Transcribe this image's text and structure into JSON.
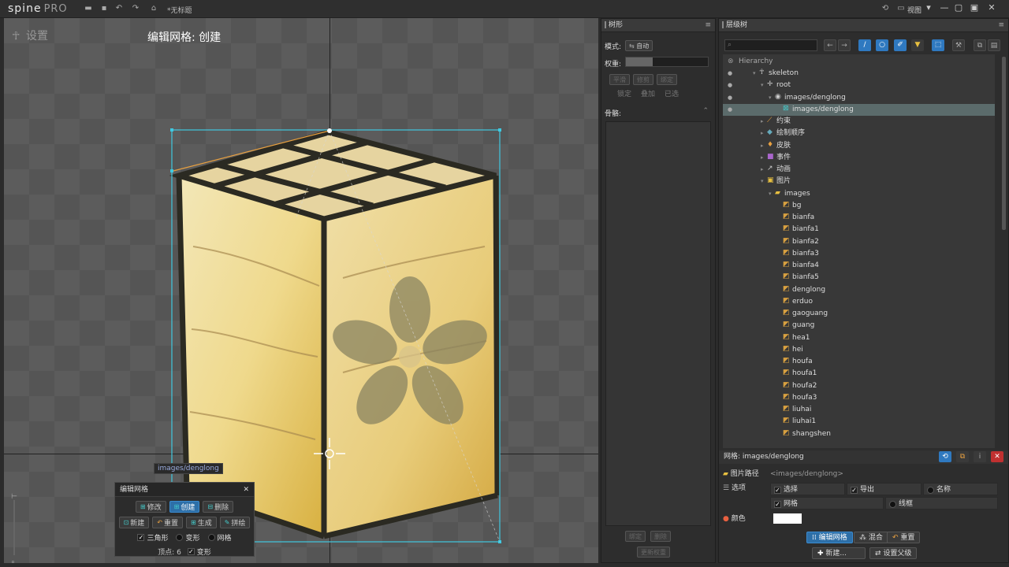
{
  "app": {
    "logo": "spine",
    "edition": "PRO",
    "doc_title": "*无标题",
    "view_menu": "视图"
  },
  "viewport": {
    "setup_label": "设置",
    "mode_label": "编辑网格: 创建",
    "attachment_tag": "images/denglong",
    "mesh_panel": {
      "title": "编辑网格",
      "row1": [
        "修改",
        "创建",
        "删除"
      ],
      "row2": [
        "新建",
        "重置",
        "生成",
        "拼绘"
      ],
      "checks": [
        {
          "label": "三角形",
          "checked": true
        },
        {
          "label": "变形",
          "checked": false
        },
        {
          "label": "网格",
          "checked": false
        }
      ],
      "vertices_label": "顶点: 6",
      "deform_label": "变形",
      "deform_checked": true
    }
  },
  "tree_panel": {
    "title": "树形",
    "mode_label": "模式:",
    "mode_value": "自动",
    "weight_label": "权重:",
    "buttons_row1": [
      "平滑",
      "修剪",
      "绑定"
    ],
    "buttons_row2": [
      "锁定",
      "叠加",
      "已选"
    ],
    "bones_label": "骨骼:",
    "footer_row1": [
      "绑定",
      "删除"
    ],
    "footer_row2": "更新权重"
  },
  "hierarchy_panel": {
    "title": "层级树",
    "root_label": "Hierarchy",
    "rows": [
      {
        "label": "skeleton",
        "indent": 1,
        "icon": "skeleton-icon",
        "eye": true
      },
      {
        "label": "root",
        "indent": 2,
        "icon": "bone-icon",
        "eye": true
      },
      {
        "label": "images/denglong",
        "indent": 3,
        "icon": "slot-icon",
        "eye": true
      },
      {
        "label": "images/denglong",
        "indent": 4,
        "icon": "mesh-icon",
        "eye": true,
        "selected": true
      },
      {
        "label": "约束",
        "indent": 2,
        "icon": "constraint-icon",
        "eye": false
      },
      {
        "label": "绘制顺序",
        "indent": 2,
        "icon": "draworder-icon",
        "eye": false
      },
      {
        "label": "皮肤",
        "indent": 2,
        "icon": "skin-icon",
        "eye": false
      },
      {
        "label": "事件",
        "indent": 2,
        "icon": "event-icon",
        "eye": false
      },
      {
        "label": "动画",
        "indent": 2,
        "icon": "animation-icon",
        "eye": false
      },
      {
        "label": "图片",
        "indent": 2,
        "icon": "images-icon",
        "eye": false
      },
      {
        "label": "images",
        "indent": 3,
        "icon": "folder-icon",
        "eye": false
      },
      {
        "label": "bg",
        "indent": 4,
        "icon": "image-icon",
        "eye": false
      },
      {
        "label": "bianfa",
        "indent": 4,
        "icon": "image-icon",
        "eye": false
      },
      {
        "label": "bianfa1",
        "indent": 4,
        "icon": "image-icon",
        "eye": false
      },
      {
        "label": "bianfa2",
        "indent": 4,
        "icon": "image-icon",
        "eye": false
      },
      {
        "label": "bianfa3",
        "indent": 4,
        "icon": "image-icon",
        "eye": false
      },
      {
        "label": "bianfa4",
        "indent": 4,
        "icon": "image-icon",
        "eye": false
      },
      {
        "label": "bianfa5",
        "indent": 4,
        "icon": "image-icon",
        "eye": false
      },
      {
        "label": "denglong",
        "indent": 4,
        "icon": "image-icon",
        "eye": false
      },
      {
        "label": "erduo",
        "indent": 4,
        "icon": "image-icon",
        "eye": false
      },
      {
        "label": "gaoguang",
        "indent": 4,
        "icon": "image-icon",
        "eye": false
      },
      {
        "label": "guang",
        "indent": 4,
        "icon": "image-icon",
        "eye": false
      },
      {
        "label": "hea1",
        "indent": 4,
        "icon": "image-icon",
        "eye": false
      },
      {
        "label": "hei",
        "indent": 4,
        "icon": "image-icon",
        "eye": false
      },
      {
        "label": "houfa",
        "indent": 4,
        "icon": "image-icon",
        "eye": false
      },
      {
        "label": "houfa1",
        "indent": 4,
        "icon": "image-icon",
        "eye": false
      },
      {
        "label": "houfa2",
        "indent": 4,
        "icon": "image-icon",
        "eye": false
      },
      {
        "label": "houfa3",
        "indent": 4,
        "icon": "image-icon",
        "eye": false
      },
      {
        "label": "liuhai",
        "indent": 4,
        "icon": "image-icon",
        "eye": false
      },
      {
        "label": "liuhai1",
        "indent": 4,
        "icon": "image-icon",
        "eye": false
      },
      {
        "label": "shangshen",
        "indent": 4,
        "icon": "image-icon",
        "eye": false
      }
    ],
    "props": {
      "title": "网格: images/denglong",
      "image_path_label": "图片路径",
      "image_path_value": "<images/denglong>",
      "options_label": "选项",
      "options": [
        {
          "label": "选择",
          "checked": true
        },
        {
          "label": "导出",
          "checked": true
        },
        {
          "label": "名称",
          "checked": false
        }
      ],
      "options2": [
        {
          "label": "网格",
          "checked": true
        },
        {
          "label": "线框",
          "checked": false
        }
      ],
      "color_label": "颜色",
      "color_value": "#ffffff",
      "btn_edit_mesh": "编辑网格",
      "btn_tween": "混合",
      "btn_reset": "重置",
      "btn_new": "新建...",
      "btn_set_parent": "设置父级"
    }
  },
  "colors": {
    "accent": "#2f79c0",
    "selection_cyan": "#40c8e0"
  }
}
